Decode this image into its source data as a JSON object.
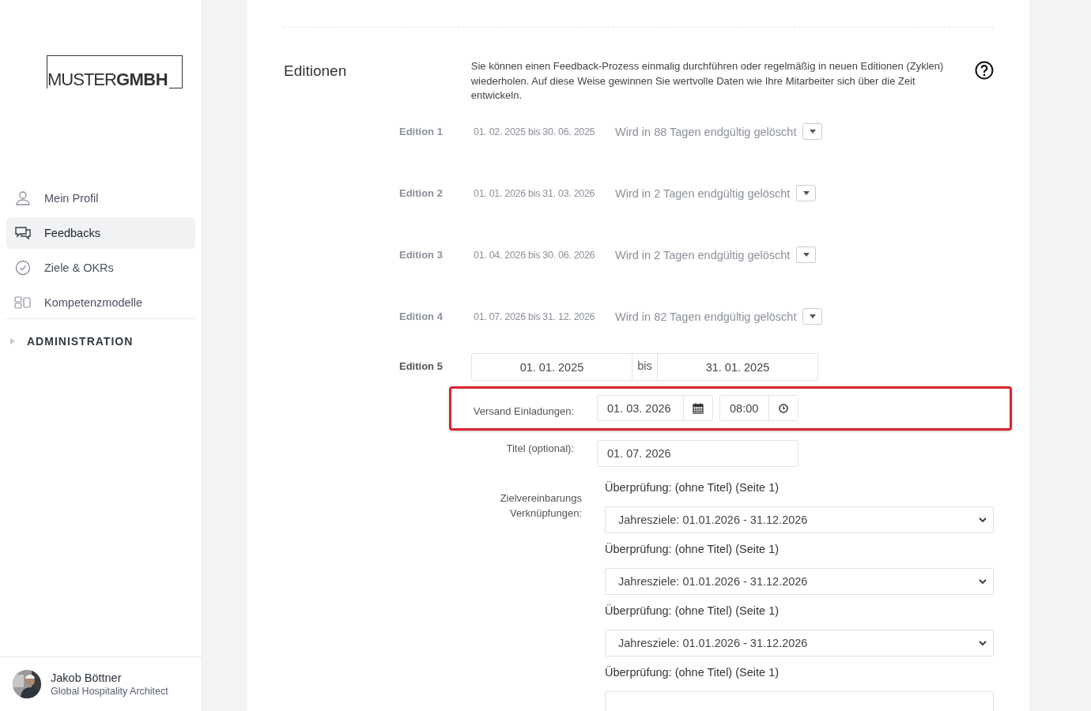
{
  "sidebar": {
    "logo": {
      "light": "MUSTER",
      "bold": "GMBH"
    },
    "items": [
      {
        "label": "Mein Profil",
        "selected": false
      },
      {
        "label": "Feedbacks",
        "selected": true
      },
      {
        "label": "Ziele & OKRs",
        "selected": false
      },
      {
        "label": "Kompetenzmodelle",
        "selected": false
      }
    ],
    "section": {
      "label": "ADMINISTRATION",
      "expanded": false
    },
    "user": {
      "name": "Jakob Böttner",
      "role": "Global Hospitality Architect"
    }
  },
  "section": {
    "title": "Editionen",
    "description": "Sie können einen Feedback-Prozess einmalig durchführen oder regelmäßig in neuen Editionen (Zyklen) wiederholen. Auf diese Weise gewinnen Sie wertvolle Daten wie Ihre Mitarbeiter sich über die Zeit entwickeln.",
    "editions": [
      {
        "label": "Edition 1",
        "range": "01. 02. 2025 bis 30. 06. 2025",
        "status": "Wird in 88 Tagen endgültig gelöscht"
      },
      {
        "label": "Edition 2",
        "range": "01. 01. 2026 bis 31. 03. 2026",
        "status": "Wird in 2 Tagen endgültig gelöscht"
      },
      {
        "label": "Edition 3",
        "range": "01. 04. 2026 bis 30. 06. 2026",
        "status": "Wird in 2 Tagen endgültig gelöscht"
      },
      {
        "label": "Edition 4",
        "range": "01. 07. 2026 bis 31. 12. 2026",
        "status": "Wird in 82 Tagen endgültig gelöscht"
      }
    ],
    "new_edition": {
      "label": "Edition 5",
      "start": "01. 01. 2025",
      "separator": "bis",
      "end": "31. 01. 2025",
      "invitation": {
        "label": "Versand Einladungen:",
        "date": "01. 03. 2026",
        "time": "08:00",
        "highlighted": true
      },
      "title_field": {
        "label": "Titel (optional):",
        "value": "01. 07. 2026"
      },
      "links_label": [
        "Zielvereinbarungs",
        "Verknüpfungen:"
      ],
      "links": [
        {
          "kind": "select",
          "label": "Überprüfung: (ohne Titel) (Seite 1)",
          "value": "Jahresziele: 01.01.2026 - 31.12.2026"
        },
        {
          "kind": "select",
          "label": "Überprüfung: (ohne Titel) (Seite 1)",
          "value": "Jahresziele: 01.01.2026 - 31.12.2026"
        },
        {
          "kind": "select",
          "label": "Überprüfung: (ohne Titel) (Seite 1)",
          "value": "Jahresziele: 01.01.2026 - 31.12.2026"
        },
        {
          "kind": "cut",
          "label": "Überprüfung: (ohne Titel) (Seite 1)"
        }
      ]
    }
  }
}
